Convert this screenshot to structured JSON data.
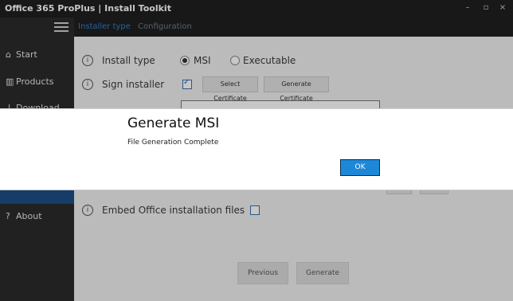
{
  "window": {
    "title": "Office 365 ProPlus | Install Toolkit",
    "controls": {
      "minimize": "–",
      "maximize": "▫",
      "close": "×"
    }
  },
  "sidebar": {
    "items": [
      {
        "label": "Start",
        "icon": "home-icon",
        "glyph": "⌂"
      },
      {
        "label": "Products",
        "icon": "grid-icon",
        "glyph": "▥"
      },
      {
        "label": "Download",
        "icon": "download-icon",
        "glyph": "↓"
      },
      {
        "label": "About",
        "icon": "question-icon",
        "glyph": "?"
      }
    ]
  },
  "header": {
    "tabs": [
      "Installer type",
      "Configuration"
    ]
  },
  "form": {
    "install_type": {
      "label": "Install type",
      "options": [
        {
          "label": "MSI",
          "selected": true
        },
        {
          "label": "Executable",
          "selected": false
        }
      ]
    },
    "sign_installer": {
      "label": "Sign installer",
      "checked": true,
      "select_certificate": "Select Certificate",
      "generate_certificate": "Generate Certificate"
    },
    "embed_files": {
      "label": "Embed Office installation files",
      "checked": false
    },
    "info_glyph": "i"
  },
  "buttons": {
    "previous": "Previous",
    "generate": "Generate"
  },
  "dialog": {
    "title": "Generate MSI",
    "message": "File Generation Complete",
    "ok": "OK"
  },
  "colors": {
    "accent": "#1e88d8",
    "sidebar_bg": "#2b2b2b",
    "active_item": "#1b4f86",
    "titlebar_bg": "#1f1f1f"
  }
}
